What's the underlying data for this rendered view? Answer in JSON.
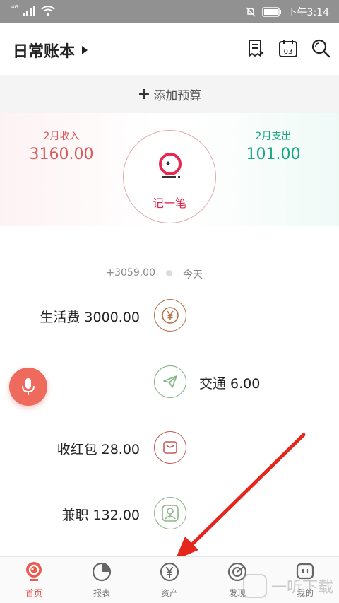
{
  "status_bar": {
    "network": "4G",
    "time": "下午3:14"
  },
  "header": {
    "title": "日常账本",
    "calendar_day": "03"
  },
  "budget": {
    "label": "添加预算"
  },
  "summary": {
    "income_label": "2月收入",
    "income_value": "3160.00",
    "expense_label": "2月支出",
    "expense_value": "101.00",
    "record_label": "记一笔"
  },
  "timeline": {
    "day_net": "+3059.00",
    "day_label": "今天",
    "entries": [
      {
        "text": "生活费 3000.00",
        "icon": "yen-icon",
        "color": "#b8734b"
      },
      {
        "text": "交通 6.00",
        "icon": "paper-plane-icon",
        "color": "#7fb383"
      },
      {
        "text": "收红包 28.00",
        "icon": "envelope-icon",
        "color": "#c95a5a"
      },
      {
        "text": "兼职 132.00",
        "icon": "person-icon",
        "color": "#8fb78a"
      }
    ]
  },
  "bottom_nav": {
    "items": [
      {
        "label": "首页",
        "icon": "home-icon",
        "active": true
      },
      {
        "label": "报表",
        "icon": "pie-chart-icon",
        "active": false
      },
      {
        "label": "资产",
        "icon": "yen-circle-icon",
        "active": false
      },
      {
        "label": "发现",
        "icon": "discover-icon",
        "active": false
      },
      {
        "label": "我的",
        "icon": "profile-icon",
        "active": false
      }
    ]
  },
  "watermark": {
    "text": "一听下载"
  },
  "colors": {
    "accent": "#e25550",
    "income": "#d95a5a",
    "expense": "#1aa584"
  }
}
